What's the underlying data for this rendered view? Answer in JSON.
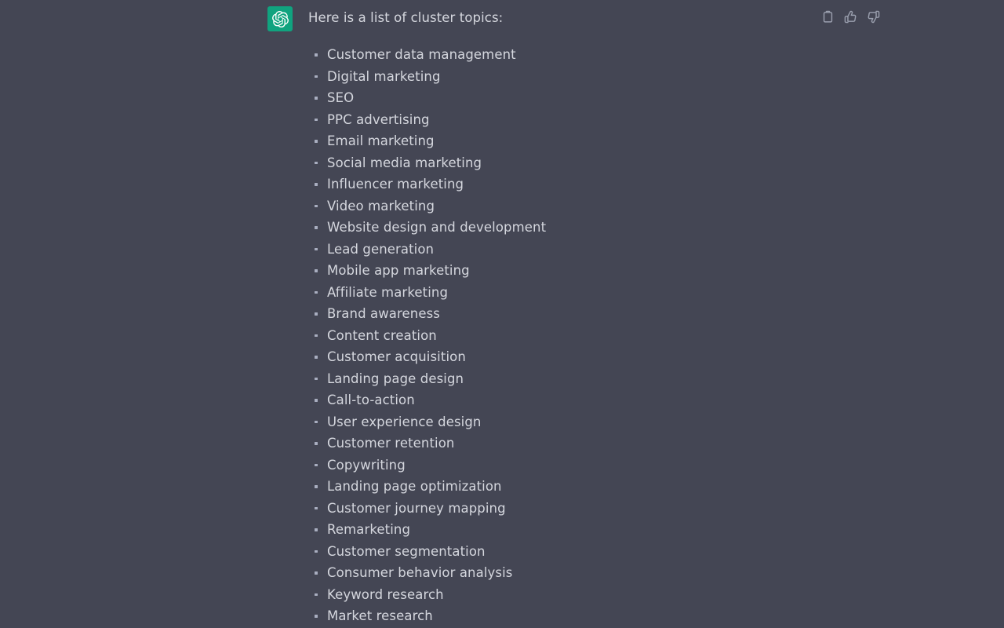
{
  "message": {
    "avatar_icon": "openai-logo-icon",
    "avatar_color": "#10a37f",
    "intro_text": "Here is a list of cluster topics:"
  },
  "actions": [
    {
      "name": "copy-button",
      "icon": "clipboard-icon",
      "label": "Copy"
    },
    {
      "name": "thumbs-up-button",
      "icon": "thumbs-up-icon",
      "label": "Good response"
    },
    {
      "name": "thumbs-down-button",
      "icon": "thumbs-down-icon",
      "label": "Bad response"
    }
  ],
  "topics": [
    "Customer data management",
    "Digital marketing",
    "SEO",
    "PPC advertising",
    "Email marketing",
    "Social media marketing",
    "Influencer marketing",
    "Video marketing",
    "Website design and development",
    "Lead generation",
    "Mobile app marketing",
    "Affiliate marketing",
    "Brand awareness",
    "Content creation",
    "Customer acquisition",
    "Landing page design",
    "Call-to-action",
    "User experience design",
    "Customer retention",
    "Copywriting",
    "Landing page optimization",
    "Customer journey mapping",
    "Remarketing",
    "Customer segmentation",
    "Consumer behavior analysis",
    "Keyword research",
    "Market research"
  ],
  "theme": {
    "background": "#444654",
    "text": "#d5d7de",
    "bullet": "#a9aec0",
    "icon": "#9ba0af"
  }
}
